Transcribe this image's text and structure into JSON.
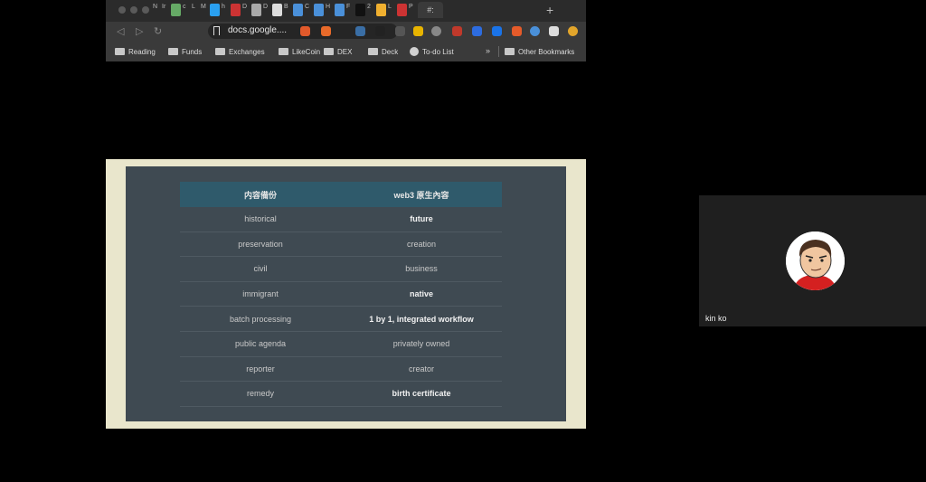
{
  "browser": {
    "url": "docs.google....",
    "tabs": [
      "N",
      "Ir",
      "",
      "c",
      "L",
      "M",
      "",
      "h",
      "",
      "D",
      "",
      "D",
      "",
      "B",
      "",
      "C",
      "",
      "H",
      "",
      "F",
      "",
      "2",
      "",
      "L",
      "",
      "P",
      "#:"
    ],
    "bookmarks": [
      {
        "label": "Reading",
        "icon": "folder-icon"
      },
      {
        "label": "Funds",
        "icon": "folder-icon"
      },
      {
        "label": "Exchanges",
        "icon": "folder-icon"
      },
      {
        "label": "LikeCoin",
        "icon": "folder-icon"
      },
      {
        "label": "DEX",
        "icon": "folder-icon"
      },
      {
        "label": "Deck",
        "icon": "folder-icon"
      },
      {
        "label": "To-do List",
        "icon": "globe-icon"
      }
    ],
    "overflow": "»",
    "other_bookmarks": "Other Bookmarks"
  },
  "slide": {
    "headers": [
      "内容備份",
      "web3 原生內容"
    ],
    "rows": [
      {
        "left": "historical",
        "right": "future",
        "bold": true
      },
      {
        "left": "preservation",
        "right": "creation",
        "bold": false
      },
      {
        "left": "civil",
        "right": "business",
        "bold": false
      },
      {
        "left": "immigrant",
        "right": "native",
        "bold": true
      },
      {
        "left": "batch processing",
        "right": "1 by 1, integrated workflow",
        "bold": true
      },
      {
        "left": "public agenda",
        "right": "privately owned",
        "bold": false
      },
      {
        "left": "reporter",
        "right": "creator",
        "bold": false
      },
      {
        "left": "remedy",
        "right": "birth certificate",
        "bold": true
      }
    ]
  },
  "participant": {
    "name": "kin ko"
  },
  "colors": {
    "slide_bg": "#3f4a52",
    "header_bg": "#2f5a6b",
    "slide_frame": "#e9e6cc"
  }
}
